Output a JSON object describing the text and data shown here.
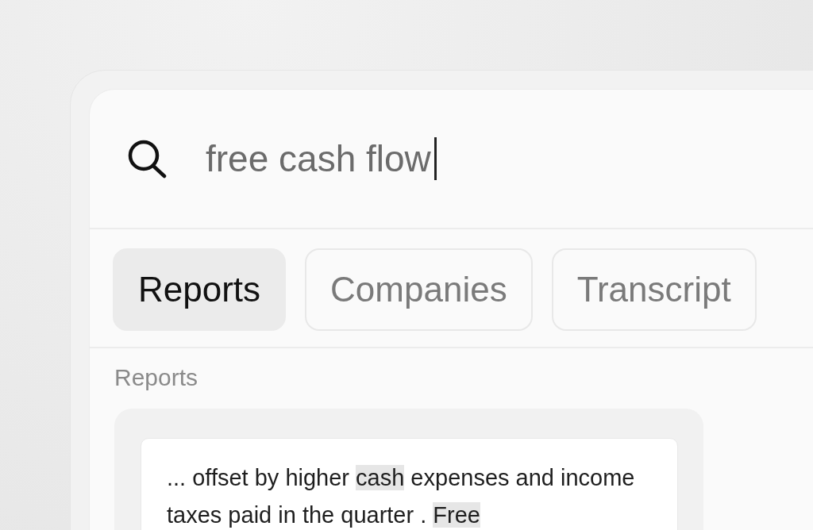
{
  "search": {
    "value": "free cash flow"
  },
  "tabs": [
    {
      "label": "Reports",
      "selected": true
    },
    {
      "label": "Companies",
      "selected": false
    },
    {
      "label": "Transcript",
      "selected": false
    }
  ],
  "section": {
    "label": "Reports"
  },
  "results": [
    {
      "snippet": [
        {
          "text": "... offset by higher ",
          "highlighted": false
        },
        {
          "text": "cash",
          "highlighted": true
        },
        {
          "text": " expenses and income taxes paid in the quarter . ",
          "highlighted": false
        },
        {
          "text": "Free",
          "highlighted": true
        }
      ]
    }
  ]
}
